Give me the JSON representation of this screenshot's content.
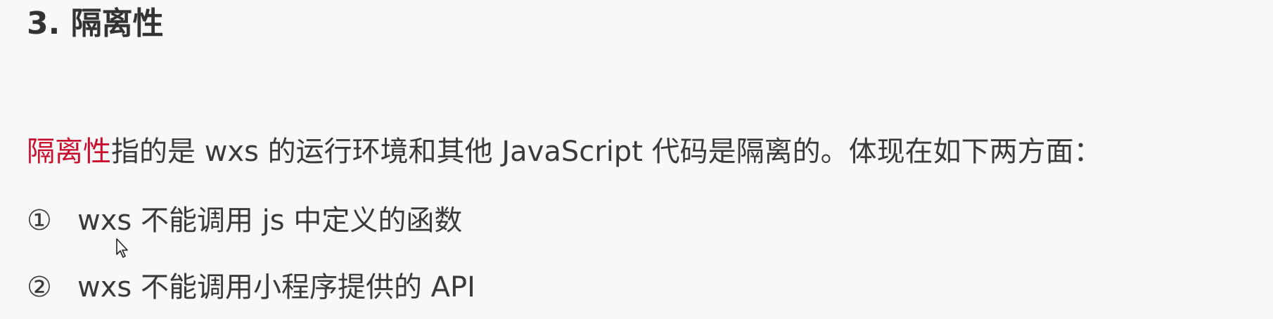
{
  "heading": "3. 隔离性",
  "intro": {
    "highlight": "隔离性",
    "text": "指的是 wxs 的运行环境和其他 JavaScript 代码是隔离的。体现在如下两方面："
  },
  "items": [
    {
      "marker": "①",
      "text": "wxs 不能调用 js 中定义的函数"
    },
    {
      "marker": "②",
      "text": "wxs 不能调用小程序提供的 API"
    }
  ],
  "colors": {
    "highlight": "#c8102e",
    "text": "#3a3a3a",
    "background": "#f8f8f8"
  },
  "icons": {
    "cursor": "mouse-pointer-icon"
  }
}
